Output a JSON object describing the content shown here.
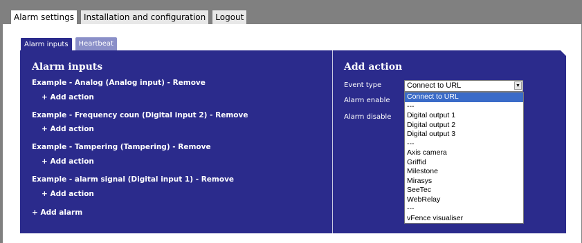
{
  "top_tabs": [
    "Alarm settings",
    "Installation and configuration",
    "Logout"
  ],
  "sub_tabs": [
    "Alarm inputs",
    "Heartbeat"
  ],
  "alarm_inputs": {
    "title": "Alarm inputs",
    "items": [
      "Example - Analog (Analog input) - Remove",
      "Example - Frequency coun (Digital input 2) - Remove",
      "Example - Tampering (Tampering) - Remove",
      "Example - alarm signal (Digital input 1) - Remove"
    ],
    "add_action_label": "+ Add action",
    "add_alarm_label": "+ Add alarm"
  },
  "add_action": {
    "title": "Add action",
    "event_type_label": "Event type",
    "alarm_enable_label": "Alarm enable",
    "alarm_disable_label": "Alarm disable",
    "selected_value": "Connect to URL",
    "options": [
      "Connect to URL",
      "---",
      "Digital output 1",
      "Digital output 2",
      "Digital output 3",
      "---",
      "Axis camera",
      "Griffid",
      "Milestone",
      "Mirasys",
      "SeeTec",
      "WebRelay",
      "---",
      "vFence visualiser"
    ]
  },
  "colors": {
    "panel_blue": "#2b2b8c",
    "selection_blue": "#3a6bc8",
    "frame_gray": "#808080"
  }
}
